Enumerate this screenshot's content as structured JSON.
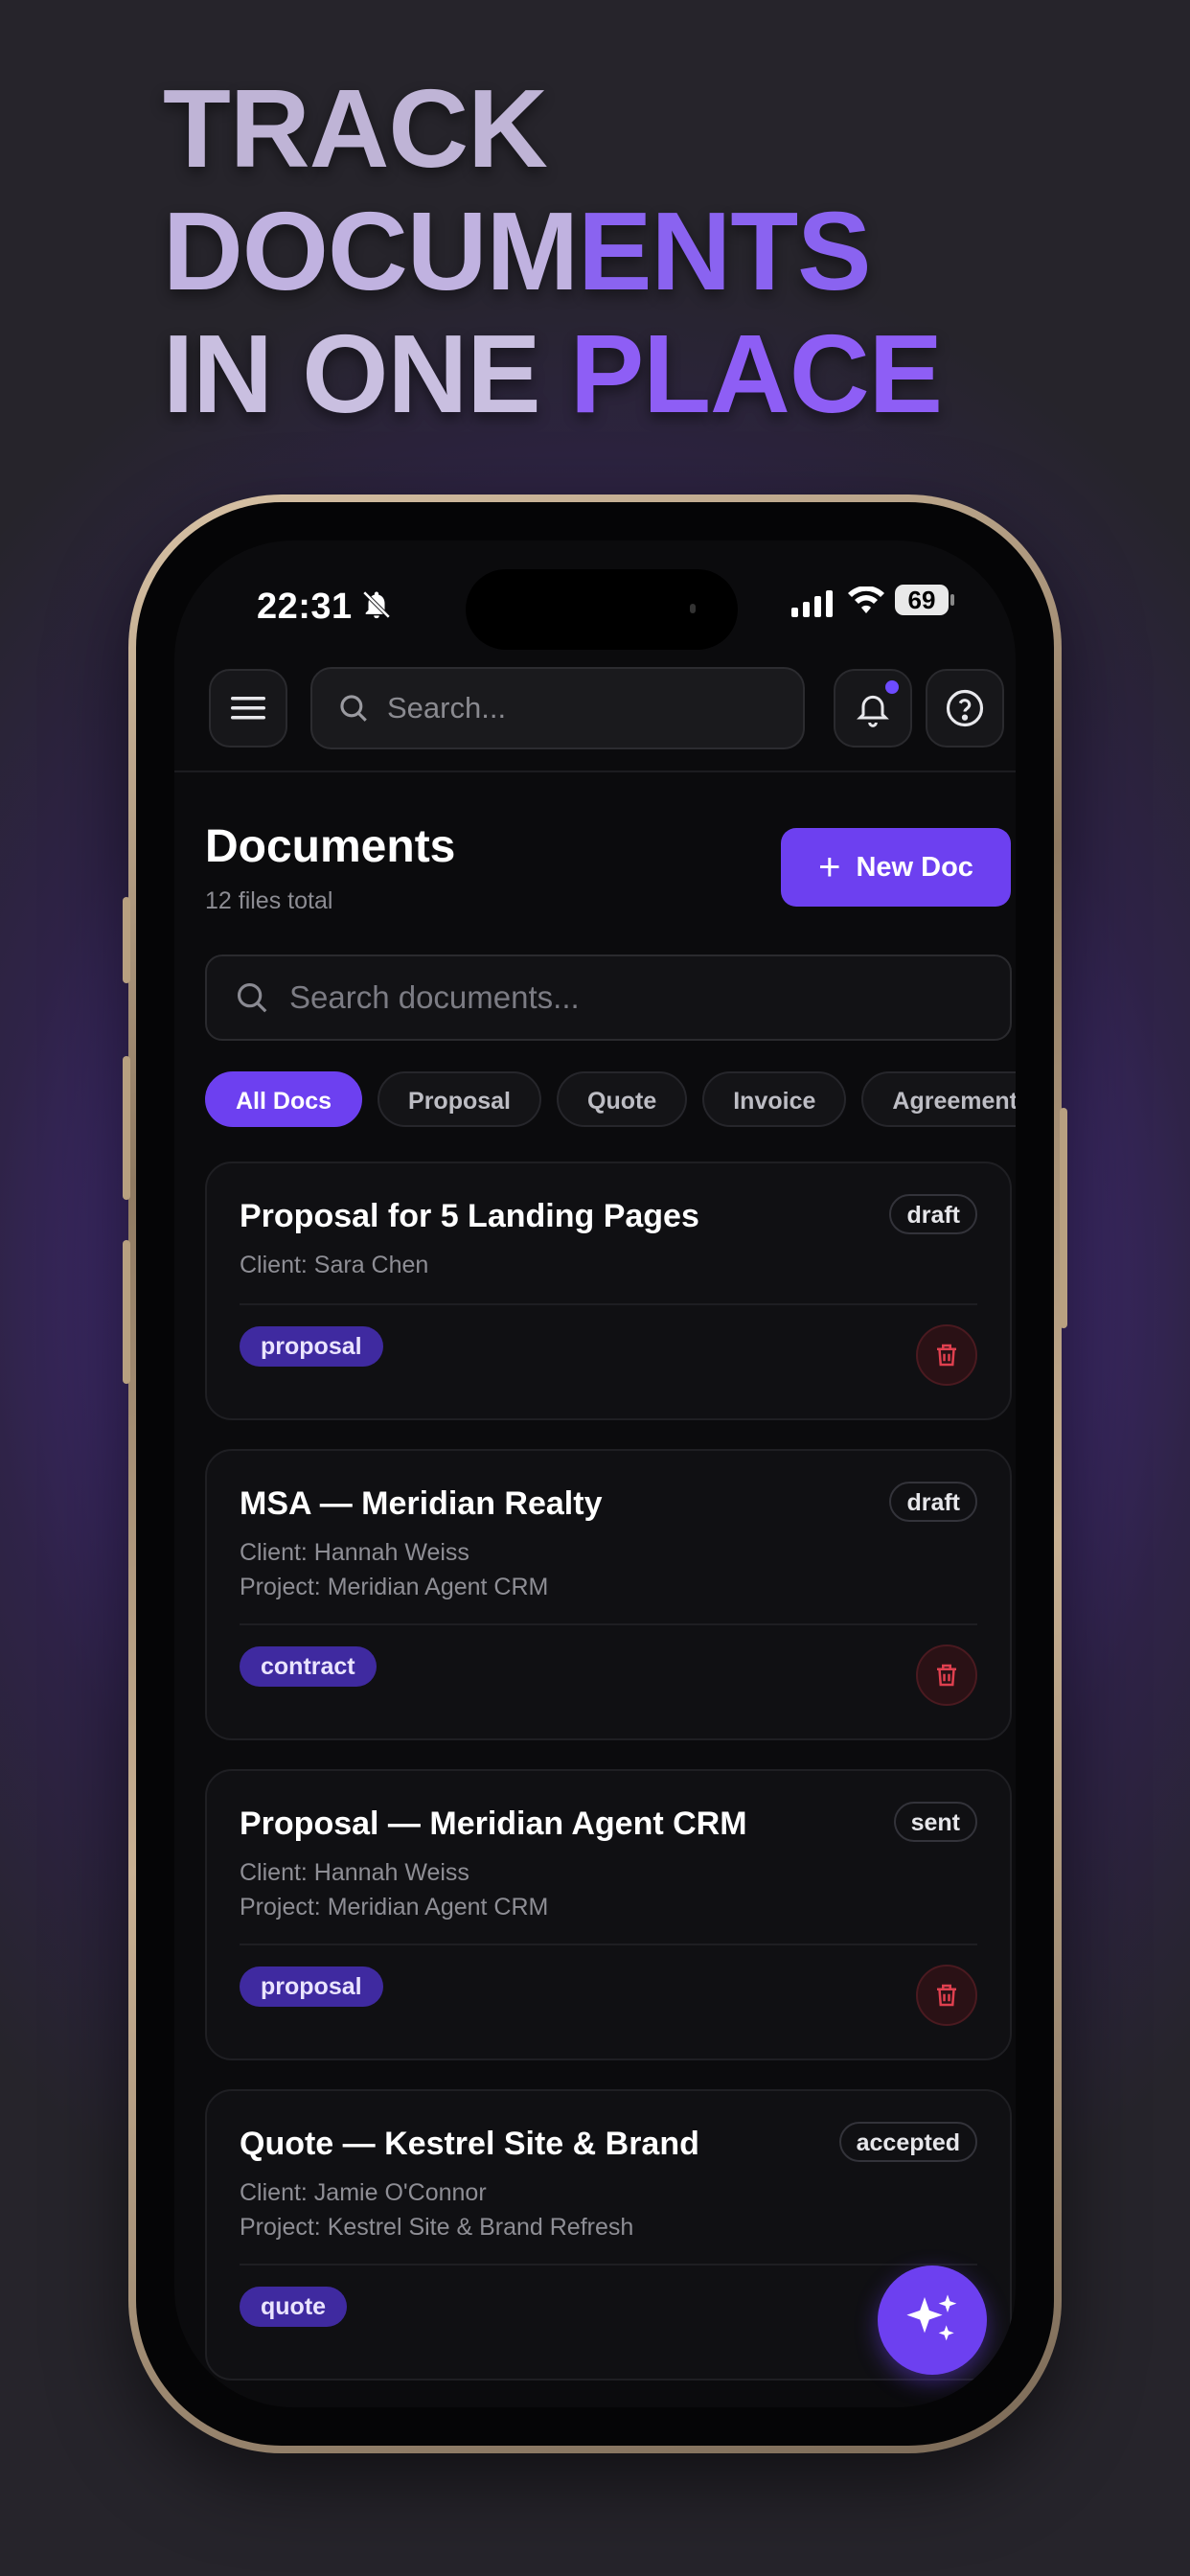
{
  "headline": {
    "line1": "TRACK",
    "line2_a": "DOCUM",
    "line2_b": "ENTS",
    "line3_a": "IN ONE ",
    "line3_b": "PLACE"
  },
  "status_bar": {
    "time": "22:31",
    "battery": "69"
  },
  "top_bar": {
    "search_placeholder": "Search..."
  },
  "header": {
    "title": "Documents",
    "subtitle": "12 files total",
    "new_doc_label": "New Doc"
  },
  "doc_search": {
    "placeholder": "Search documents..."
  },
  "filters": [
    "All Docs",
    "Proposal",
    "Quote",
    "Invoice",
    "Agreement"
  ],
  "documents": [
    {
      "title": "Proposal for 5 Landing Pages",
      "status": "draft",
      "client": "Client: Sara Chen",
      "project": "",
      "tag": "proposal"
    },
    {
      "title": "MSA — Meridian Realty",
      "status": "draft",
      "client": "Client: Hannah Weiss",
      "project": "Project: Meridian Agent CRM",
      "tag": "contract"
    },
    {
      "title": "Proposal — Meridian Agent CRM",
      "status": "sent",
      "client": "Client: Hannah Weiss",
      "project": "Project: Meridian Agent CRM",
      "tag": "proposal"
    },
    {
      "title": "Quote — Kestrel Site & Brand",
      "status": "accepted",
      "client": "Client: Jamie O'Connor",
      "project": "Project: Kestrel Site & Brand Refresh",
      "tag": "quote"
    }
  ],
  "colors": {
    "accent": "#6d40f0",
    "tag_bg": "#3f2aa0",
    "delete": "#e0404f",
    "background": "#0b0b0d"
  },
  "icons": {
    "menu": "hamburger-icon",
    "search": "search-icon",
    "notifications": "bell-icon",
    "help": "help-icon",
    "delete": "trash-icon",
    "fab": "sparkles-icon"
  }
}
